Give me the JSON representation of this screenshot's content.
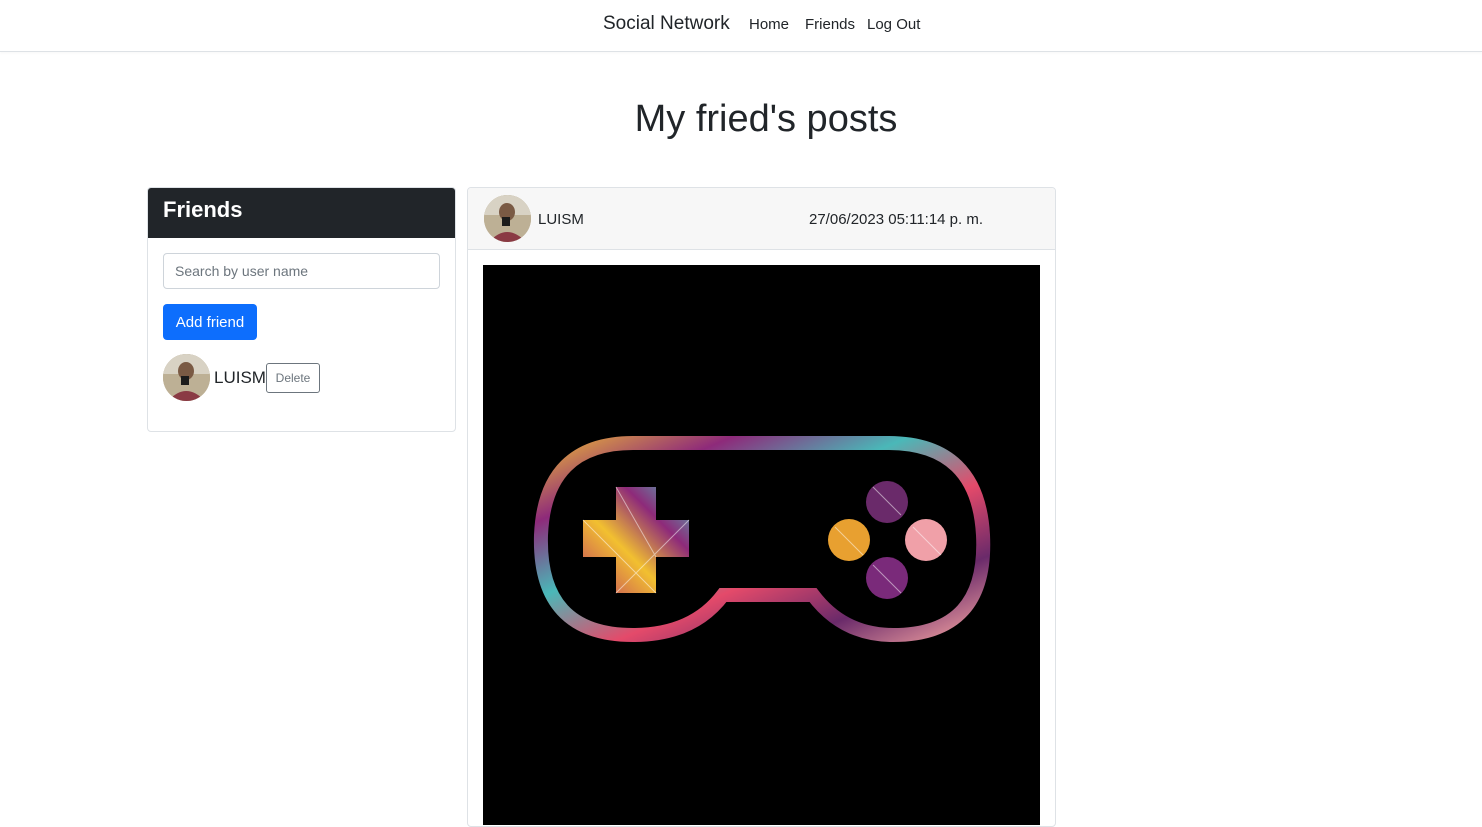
{
  "nav": {
    "brand": "Social Network",
    "links": [
      "Home",
      "Friends",
      "Log Out"
    ]
  },
  "page": {
    "title": "My fried's posts"
  },
  "friends_panel": {
    "title": "Friends",
    "search_placeholder": "Search by user name",
    "add_button": "Add friend",
    "friends": [
      {
        "name": "LUISM",
        "delete_label": "Delete"
      }
    ]
  },
  "post": {
    "author": "LUISM",
    "date": "27/06/2023 05:11:14 p. m.",
    "image": "gamepad-controller-mosaic"
  },
  "colors": {
    "primary": "#0d6efd",
    "dark": "#212529",
    "post_header_bg": "#f7f7f7"
  }
}
